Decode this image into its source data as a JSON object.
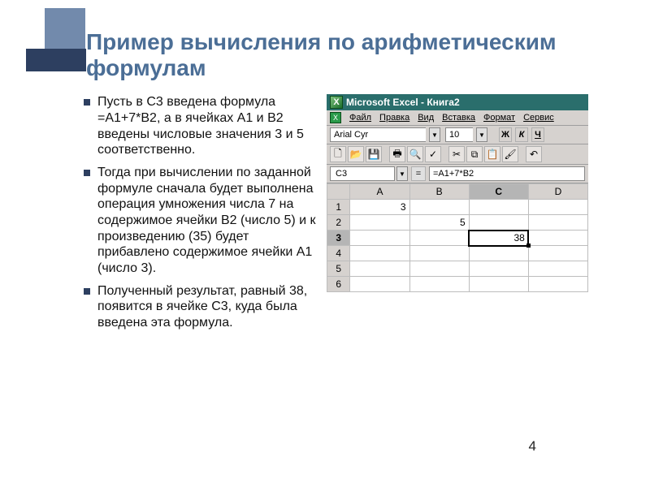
{
  "title": "Пример вычисления по арифметическим формулам",
  "bullets": [
    "Пусть в С3 введена формула =А1+7*В2, а в ячейках А1 и В2 введены числовые значения 3 и 5 соответственно.",
    "Тогда при вычислении по заданной формуле сначала будет выполнена операция умножения числа 7 на содержимое ячейки В2 (число 5) и к произведению (35) будет прибавлено содержимое ячейки А1 (число 3).",
    "Полученный результат, равный 38, появится в ячейке С3, куда была введена эта формула."
  ],
  "excel": {
    "title": "Microsoft Excel - Книга2",
    "menu": [
      "Файл",
      "Правка",
      "Вид",
      "Вставка",
      "Формат",
      "Сервис"
    ],
    "font_name": "Arial Cyr",
    "font_size": "10",
    "name_box": "C3",
    "formula": "=A1+7*B2",
    "columns": [
      "A",
      "B",
      "C",
      "D"
    ],
    "rows": [
      "1",
      "2",
      "3",
      "4",
      "5",
      "6"
    ],
    "cells": {
      "A1": "3",
      "B2": "5",
      "C3": "38"
    },
    "active_col": "C",
    "active_row": "3"
  },
  "page_number": "4",
  "chart_data": {
    "type": "table",
    "title": "Spreadsheet cell values",
    "columns": [
      "A",
      "B",
      "C",
      "D"
    ],
    "rows": [
      {
        "row": 1,
        "A": 3,
        "B": null,
        "C": null,
        "D": null
      },
      {
        "row": 2,
        "A": null,
        "B": 5,
        "C": null,
        "D": null
      },
      {
        "row": 3,
        "A": null,
        "B": null,
        "C": 38,
        "D": null
      },
      {
        "row": 4,
        "A": null,
        "B": null,
        "C": null,
        "D": null
      },
      {
        "row": 5,
        "A": null,
        "B": null,
        "C": null,
        "D": null
      },
      {
        "row": 6,
        "A": null,
        "B": null,
        "C": null,
        "D": null
      }
    ],
    "formula_cell": {
      "cell": "C3",
      "formula": "=A1+7*B2",
      "result": 38
    }
  }
}
